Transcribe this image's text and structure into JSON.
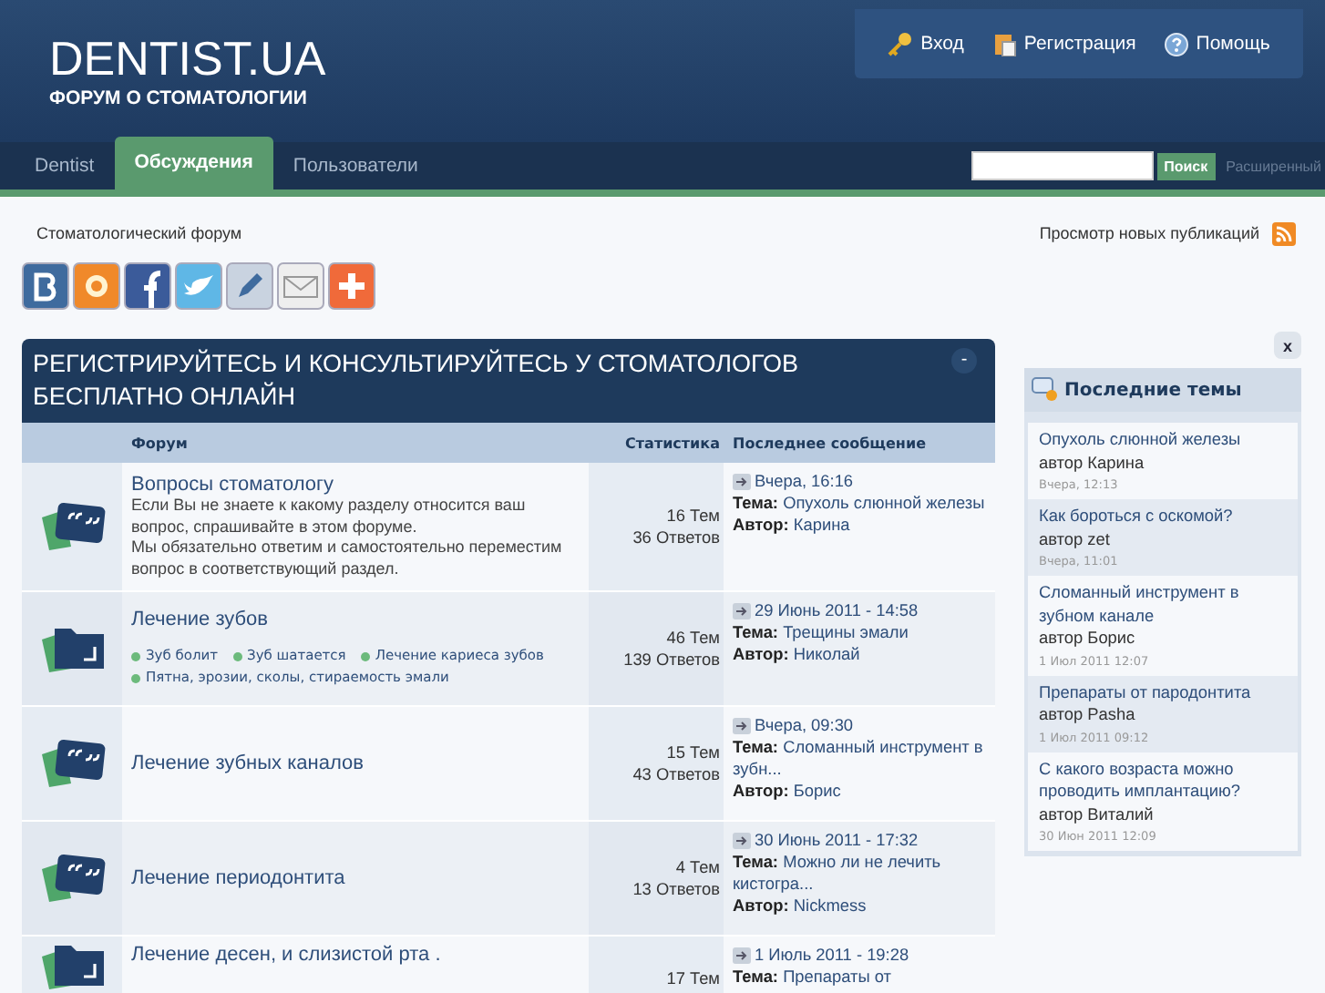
{
  "header": {
    "logo": "DENTIST.UA",
    "tagline": "ФОРУМ О СТОМАТОЛОГИИ",
    "user_links": [
      {
        "kind": "key",
        "label": "Вход"
      },
      {
        "kind": "clipboard",
        "label": "Регистрация"
      },
      {
        "kind": "help",
        "label": "Помощь"
      }
    ]
  },
  "nav": {
    "tabs": [
      {
        "label": "Dentist",
        "selected": false
      },
      {
        "label": "Обсуждения",
        "selected": true
      },
      {
        "label": "Пользователи",
        "selected": false
      }
    ],
    "search_button": "Поиск",
    "advanced": "Расширенный"
  },
  "breadcrumb": "Стоматологический форум",
  "new_posts": "Просмотр новых публикаций",
  "share_icons": [
    {
      "kind": "vk"
    },
    {
      "kind": "odnoklassniki"
    },
    {
      "kind": "facebook"
    },
    {
      "kind": "twitter"
    },
    {
      "kind": "livejournal"
    },
    {
      "kind": "mail"
    },
    {
      "kind": "more"
    }
  ],
  "category": {
    "title": "РЕГИСТРИРУЙТЕСЬ И КОНСУЛЬТИРУЙТЕСЬ У СТОМАТОЛОГОВ БЕСПЛАТНО ОНЛАЙН",
    "collapse": "-",
    "columns": [
      "Форум",
      "Статистика",
      "Последнее сообщение"
    ],
    "rows": [
      {
        "kind": "speech",
        "title": "Вопросы стоматологу",
        "description": "Если Вы не знаете к какому разделу относится ваш вопрос, спрашивайте в этом форуме.\nМы обязательно ответим и самостоятельно переместим вопрос в соответствующий раздел.",
        "topics": "16 Тем",
        "replies": "36 Ответов",
        "date": "Вчера, 16:16",
        "topic_label": "Тема:",
        "topic": "Опухоль слюнной железы",
        "author_label": "Автор:",
        "author": "Карина"
      },
      {
        "kind": "folder",
        "title": "Лечение зубов",
        "subforums": [
          "Зуб болит",
          "Зуб шатается",
          "Лечение кариеса зубов",
          "Пятна, эрозии, сколы, стираемость эмали"
        ],
        "topics": "46 Тем",
        "replies": "139 Ответов",
        "date": "29 Июнь 2011 - 14:58",
        "topic_label": "Тема:",
        "topic": "Трещины эмали",
        "author_label": "Автор:",
        "author": "Николай"
      },
      {
        "kind": "speech",
        "title": "Лечение зубных каналов",
        "topics": "15 Тем",
        "replies": "43 Ответов",
        "date": "Вчера, 09:30",
        "topic_label": "Тема:",
        "topic": "Сломанный инструмент в зубн...",
        "author_label": "Автор:",
        "author": "Борис"
      },
      {
        "kind": "speech",
        "title": "Лечение периодонтита",
        "topics": "4 Тем",
        "replies": "13 Ответов",
        "date": "30 Июнь 2011 - 17:32",
        "topic_label": "Тема:",
        "topic": "Можно ли не лечить кистогра...",
        "author_label": "Автор:",
        "author": "Nickmess"
      },
      {
        "kind": "folder",
        "title": "Лечение десен, и слизистой рта .",
        "topics": "17 Тем",
        "date": "1 Июль 2011 - 19:28",
        "topic_label": "Тема:",
        "topic": "Препараты от"
      }
    ]
  },
  "sidebar": {
    "close": "x",
    "title": "Последние темы",
    "items": [
      {
        "title": "Опухоль слюнной железы",
        "author": "автор Карина",
        "date": "Вчера, 12:13"
      },
      {
        "title": "Как бороться с оскомой?",
        "author": "автор zet",
        "date": "Вчера, 11:01"
      },
      {
        "title": "Сломанный инструмент в зубном канале",
        "author": "автор Борис",
        "date": "1 Июл 2011 12:07"
      },
      {
        "title": "Препараты от пародонтита",
        "author": "автор Pasha",
        "date": "1 Июл 2011 09:12"
      },
      {
        "title": "С какого возраста можно проводить имплантацию?",
        "author": "автор Виталий",
        "date": "30 Июн 2011 12:09"
      }
    ]
  }
}
